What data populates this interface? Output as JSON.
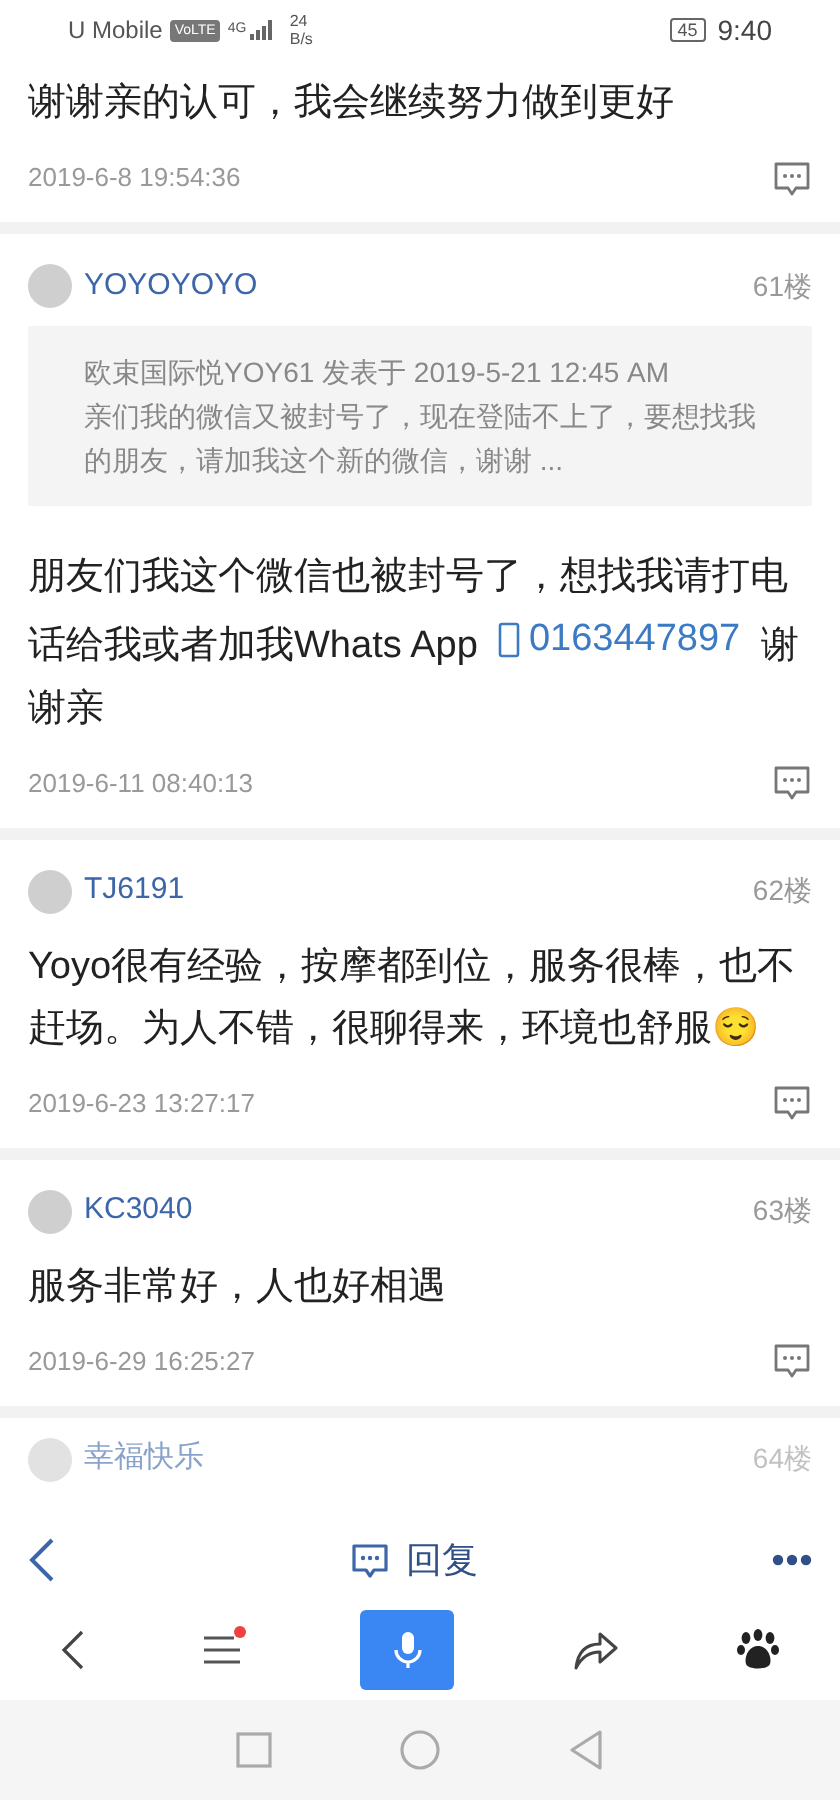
{
  "status_bar": {
    "carrier": "U Mobile",
    "network_badge": "VoLTE",
    "network_type": "4G",
    "speed_value": "24",
    "speed_unit": "B/s",
    "battery": "45",
    "time": "9:40"
  },
  "posts": [
    {
      "kind": "continuation",
      "body": [
        {
          "kind": "text",
          "text": "谢谢亲的认可，我会继续努力做到更好"
        }
      ],
      "date": "2019-6-8 19:54:36"
    },
    {
      "kind": "post",
      "user": "YOYOYOYO",
      "floor": "61楼",
      "quote": {
        "header": "欧束国际悦YOY61 发表于 2019-5-21 12:45 AM",
        "text": "亲们我的微信又被封号了，现在登陆不上了，要想找我的朋友，请加我这个新的微信，谢谢 ..."
      },
      "body": [
        {
          "kind": "text",
          "text": "朋友们我这个微信也被封号了，想找我请打电话给我或者加我Whats App  "
        },
        {
          "kind": "phone",
          "text": "0163447897"
        },
        {
          "kind": "text",
          "text": "  谢谢亲"
        }
      ],
      "date": "2019-6-11 08:40:13"
    },
    {
      "kind": "post",
      "user": "TJ6191",
      "floor": "62楼",
      "body": [
        {
          "kind": "text",
          "text": "Yoyo很有经验，按摩都到位，服务很棒，也不赶场。为人不错，很聊得来，环境也舒服😌"
        }
      ],
      "date": "2019-6-23 13:27:17"
    },
    {
      "kind": "post",
      "user": "KC3040",
      "floor": "63楼",
      "body": [
        {
          "kind": "text",
          "text": "服务非常好，人也好相遇"
        }
      ],
      "date": "2019-6-29 16:25:27"
    },
    {
      "kind": "partial",
      "user": "幸福快乐",
      "floor": "64楼"
    }
  ],
  "reply_bar": {
    "label": "回复"
  },
  "browser_toolbar": {
    "menu_notification": true
  }
}
